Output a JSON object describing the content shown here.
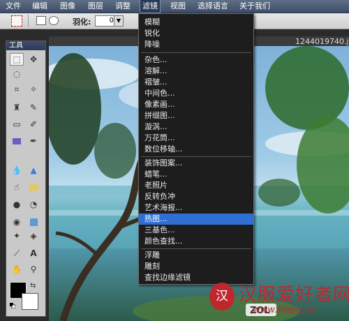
{
  "menubar": {
    "items": [
      "文件",
      "编辑",
      "图像",
      "图层",
      "调整",
      "滤镜",
      "视图",
      "选择语言",
      "关于我们"
    ],
    "active": "滤镜"
  },
  "options": {
    "feather_label": "羽化:",
    "feather_value": "0"
  },
  "tools_panel": {
    "title": "工具",
    "tools": [
      "marquee-tool",
      "move-tool",
      "lasso-tool",
      "crop-tool",
      "magic-wand-tool",
      "stamp-tool",
      "pencil-tool",
      "eraser-tool",
      "brush-tool",
      "rectangle-tool",
      "eyedropper-tool",
      "blur-tool",
      "sharpen-tool",
      "smudge-tool",
      "dodge-tool",
      "burn-tool",
      "red-eye-tool",
      "shape-tool",
      "pen-tool",
      "text-tool",
      "hand-tool",
      "zoom-tool"
    ],
    "foreground_color": "#000000",
    "background_color": "#ffffff"
  },
  "image_window": {
    "filename": "1244019740.jpg"
  },
  "filter_menu": {
    "group1": [
      "模糊",
      "锐化",
      "降噪"
    ],
    "group2": [
      "杂色...",
      "溶解...",
      "褶皱...",
      "中间色...",
      "像素画...",
      "拼缀图...",
      "漩涡...",
      "万花筒...",
      "数位移轴..."
    ],
    "group3": [
      "装饰图案...",
      "蜡笔...",
      "老照片",
      "反转负冲",
      "艺术海报...",
      "热图...",
      "三基色...",
      "颜色查找..."
    ],
    "group4": [
      "浮雕",
      "雕刻",
      "查找边缘滤镜"
    ],
    "highlighted": "热图...",
    "highlight_color": "#2f6fd4"
  },
  "watermark": {
    "seal": "汉",
    "text": "汉服爱好者网",
    "url": "www.hfahz.cn",
    "logo_text": "ZOL"
  }
}
